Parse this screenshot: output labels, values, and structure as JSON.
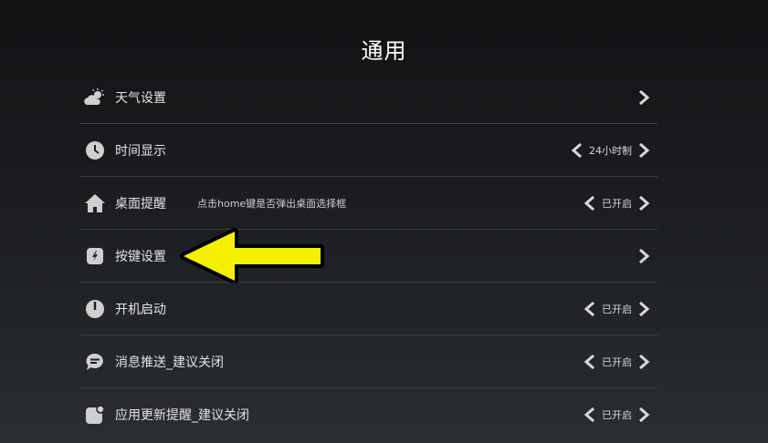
{
  "page": {
    "title": "通用"
  },
  "settings": [
    {
      "label": "天气设置",
      "desc": "",
      "value": "",
      "icon": "weather-icon"
    },
    {
      "label": "时间显示",
      "desc": "",
      "value": "24小时制",
      "icon": "clock-icon"
    },
    {
      "label": "桌面提醒",
      "desc": "点击home键是否弹出桌面选择框",
      "value": "已开启",
      "icon": "home-icon"
    },
    {
      "label": "按键设置",
      "desc": "",
      "value": "",
      "icon": "key-icon"
    },
    {
      "label": "开机启动",
      "desc": "",
      "value": "已开启",
      "icon": "power-icon"
    },
    {
      "label": "消息推送_建议关闭",
      "desc": "",
      "value": "已开启",
      "icon": "message-icon"
    },
    {
      "label": "应用更新提醒_建议关闭",
      "desc": "",
      "value": "已开启",
      "icon": "update-icon"
    }
  ],
  "annotation": {
    "icon": "yellow-arrow-icon",
    "color": "#f5f000"
  },
  "colors": {
    "background": "#1b1d20",
    "divider": "#3b3e42",
    "text": "#e4e4e4"
  }
}
